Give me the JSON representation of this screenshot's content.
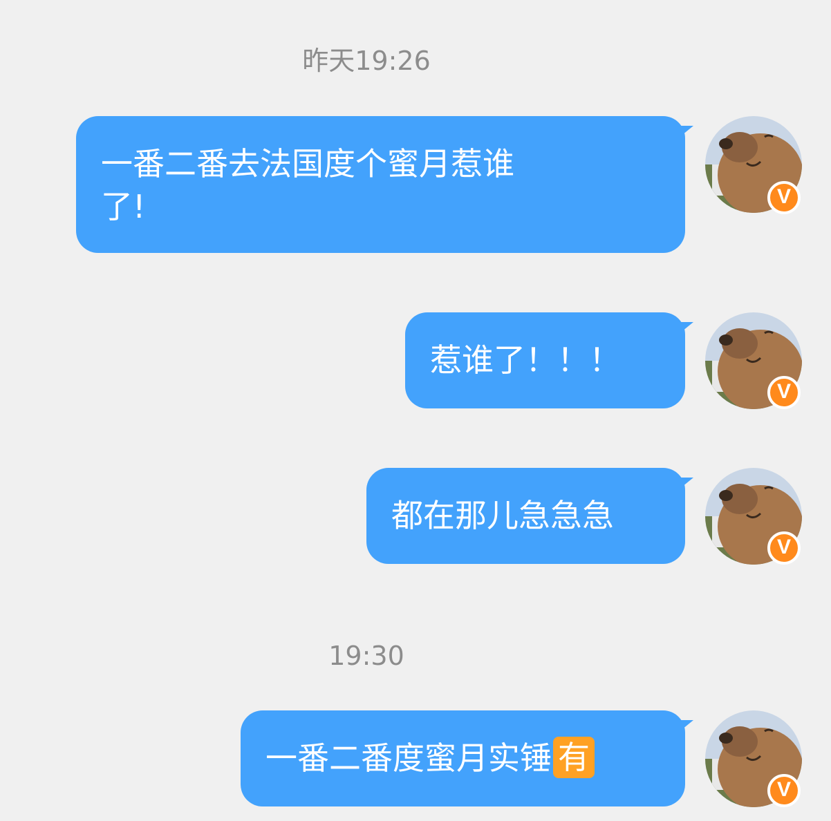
{
  "chat": {
    "timestamps": [
      "昨天19:26",
      "19:30"
    ],
    "messages": [
      {
        "text": "一番二番去法国度个蜜月惹谁了!",
        "line1": "一番二番去法国度个蜜月惹谁",
        "line2": "了!"
      },
      {
        "text": "惹谁了！！！"
      },
      {
        "text": "都在那儿急急急"
      },
      {
        "text": "一番二番度蜜月实锤",
        "emoji": "有"
      }
    ],
    "avatar": {
      "icon": "capybara-avatar-icon",
      "badge_icon": "verified-v-badge-icon",
      "badge_text": "V"
    },
    "colors": {
      "background": "#f0f0f0",
      "bubble": "#43a2fc",
      "bubble_text": "#ffffff",
      "timestamp": "#8c8c8c",
      "badge": "#ff8a1c",
      "emoji_you": "#ffa124"
    }
  }
}
